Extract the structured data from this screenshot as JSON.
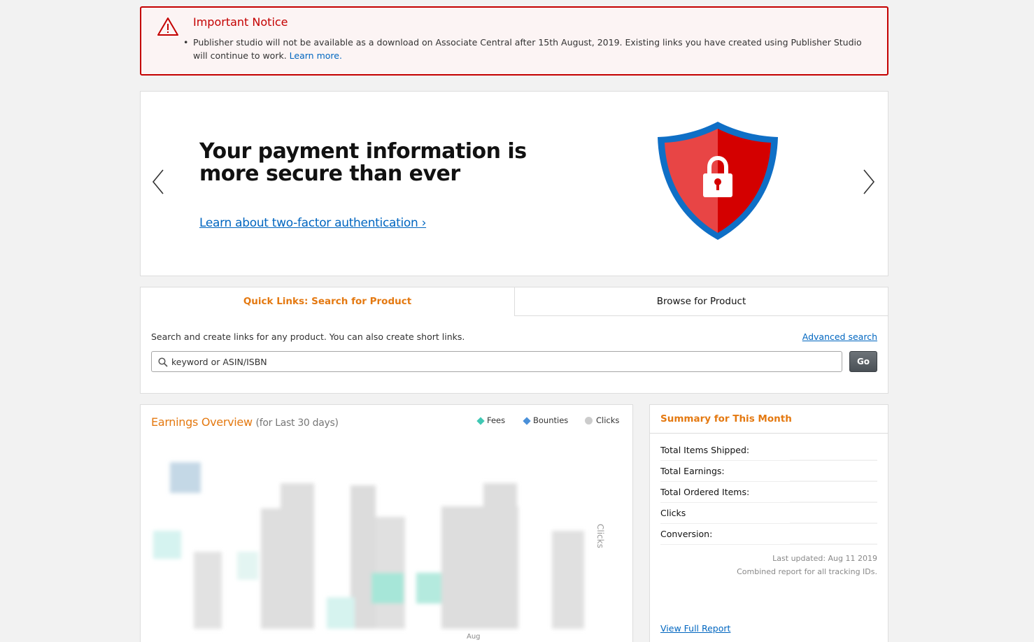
{
  "notice": {
    "title": "Important Notice",
    "body": "Publisher studio will not be available as a download on Associate Central after 15th August, 2019. Existing links you have created using Publisher Studio will continue to work.",
    "link": "Learn more.",
    "icon": "warning-triangle-icon"
  },
  "banner": {
    "headline_line1": "Your payment information is",
    "headline_line2": "more secure than ever",
    "link": "Learn about two-factor authentication ›",
    "colors": {
      "shield_outer": "#0f6fc6",
      "shield_left": "#e84545",
      "shield_right": "#d40000"
    }
  },
  "quick_links": {
    "tabs": [
      {
        "label": "Quick Links: Search for Product",
        "active": true
      },
      {
        "label": "Browse for Product",
        "active": false
      }
    ],
    "description": "Search and create links for any product. You can also create short links.",
    "advanced_search": "Advanced search",
    "search": {
      "placeholder": "keyword or ASIN/ISBN",
      "value": ""
    },
    "go_label": "Go"
  },
  "earnings": {
    "title": "Earnings Overview",
    "subtitle": "(for Last 30 days)",
    "legend": [
      {
        "label": "Fees",
        "color": "#40c8b4"
      },
      {
        "label": "Bounties",
        "color": "#4a90d9"
      },
      {
        "label": "Clicks",
        "color": "#cccccc"
      }
    ],
    "right_axis_label": "Clicks",
    "x_label": "Aug"
  },
  "summary": {
    "title": "Summary for This Month",
    "rows": [
      {
        "label": "Total Items Shipped:"
      },
      {
        "label": "Total Earnings:"
      },
      {
        "label": "Total Ordered Items:"
      },
      {
        "label": "Clicks"
      },
      {
        "label": "Conversion:"
      }
    ],
    "last_updated": "Last updated: Aug 11 2019",
    "combined": "Combined report for all tracking IDs.",
    "view_full_report": "View Full Report"
  }
}
